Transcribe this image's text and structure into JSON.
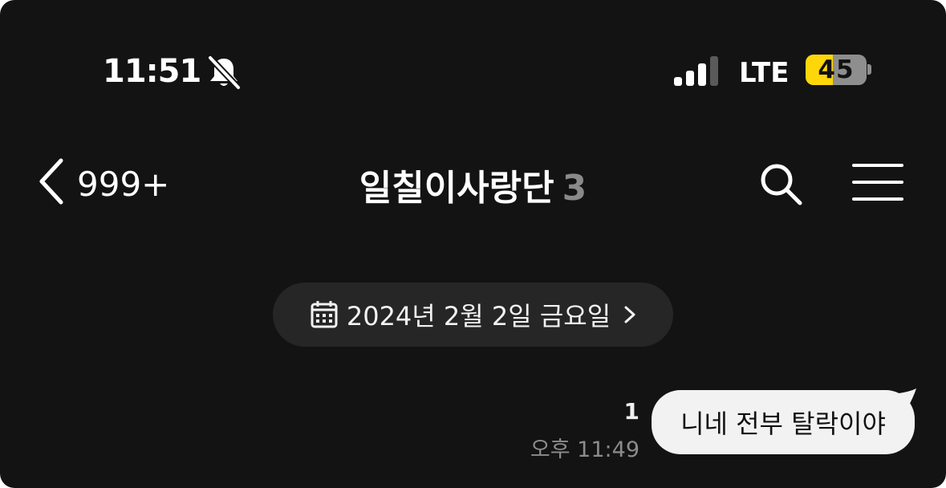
{
  "status_bar": {
    "time": "11:51",
    "network": "LTE",
    "battery": "45",
    "battery_level": 0.45
  },
  "nav": {
    "back_count": "999+",
    "title": "일칠이사랑단",
    "member_count": "3"
  },
  "date_divider": {
    "text": "2024년 2월 2일 금요일"
  },
  "messages": [
    {
      "text": "니네 전부 탈락이야",
      "unread": "1",
      "time": "오후 11:49",
      "from_me": true
    }
  ],
  "colors": {
    "background": "#131313",
    "battery_accent": "#ffd60a",
    "bubble": "#f2f2f2",
    "muted_text": "#8c8c8c"
  }
}
